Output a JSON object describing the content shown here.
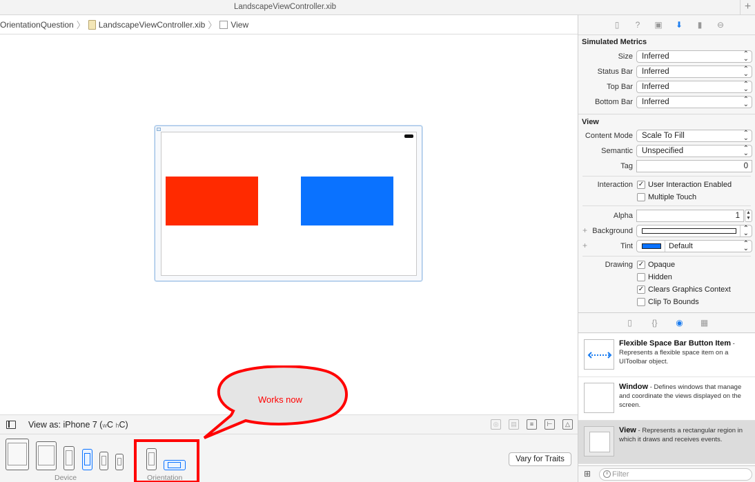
{
  "window": {
    "title": "LandscapeViewController.xib"
  },
  "jumpbar": {
    "item1": "OrientationQuestion",
    "item2": "LandscapeViewController.xib",
    "item3": "View"
  },
  "annotation": {
    "bubble_text": "Works now"
  },
  "viewas": {
    "label_prefix": "View as: iPhone 7 (",
    "wc": "w",
    "c1": "C ",
    "hc": "h",
    "c2": "C)"
  },
  "devices": {
    "device_caption": "Device",
    "orientation_caption": "Orientation",
    "vary_label": "Vary for Traits"
  },
  "inspector": {
    "simulated_metrics": {
      "title": "Simulated Metrics",
      "rows": [
        {
          "label": "Size",
          "value": "Inferred"
        },
        {
          "label": "Status Bar",
          "value": "Inferred"
        },
        {
          "label": "Top Bar",
          "value": "Inferred"
        },
        {
          "label": "Bottom Bar",
          "value": "Inferred"
        }
      ]
    },
    "view": {
      "title": "View",
      "content_mode_label": "Content Mode",
      "content_mode": "Scale To Fill",
      "semantic_label": "Semantic",
      "semantic": "Unspecified",
      "tag_label": "Tag",
      "tag": "0",
      "interaction_label": "Interaction",
      "user_interaction": "User Interaction Enabled",
      "user_interaction_checked": true,
      "multiple_touch": "Multiple Touch",
      "multiple_touch_checked": false,
      "alpha_label": "Alpha",
      "alpha": "1",
      "background_label": "Background",
      "tint_label": "Tint",
      "tint": "Default",
      "drawing_label": "Drawing",
      "opaque": "Opaque",
      "opaque_checked": true,
      "hidden": "Hidden",
      "hidden_checked": false,
      "clears": "Clears Graphics Context",
      "clears_checked": true,
      "clip": "Clip To Bounds",
      "clip_checked": false
    }
  },
  "library": {
    "items": [
      {
        "name": "Flexible Space Bar Button Item",
        "desc": "Represents a flexible space item on a UIToolbar object."
      },
      {
        "name": "Window",
        "desc": "Defines windows that manage and coordinate the views displayed on the screen."
      },
      {
        "name": "View",
        "desc": "Represents a rectangular region in which it draws and receives events."
      }
    ],
    "filter_placeholder": "Filter"
  },
  "colors": {
    "red_view": "#ff2a00",
    "blue_view": "#0a72ff",
    "annotation": "#ff0000",
    "accent": "#1a7cf0"
  }
}
